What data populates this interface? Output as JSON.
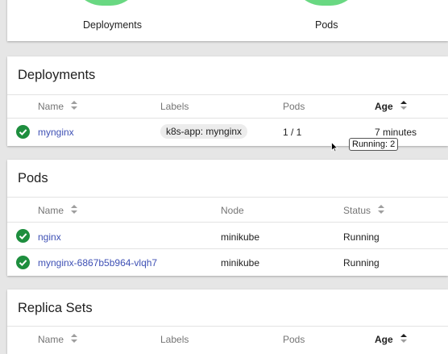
{
  "workloads": {
    "deployments_label": "Deployments",
    "pods_label": "Pods",
    "chart_color": "#69d882"
  },
  "deployments": {
    "title": "Deployments",
    "columns": {
      "name": "Name",
      "labels": "Labels",
      "pods": "Pods",
      "age": "Age"
    },
    "rows": [
      {
        "status": "check-icon",
        "name": "mynginx",
        "label": "k8s-app: mynginx",
        "pods": "1 / 1",
        "age": "7 minutes"
      }
    ],
    "tooltip": "Running: 2"
  },
  "pods": {
    "title": "Pods",
    "columns": {
      "name": "Name",
      "node": "Node",
      "status": "Status"
    },
    "rows": [
      {
        "status_icon": "check-icon",
        "name": "nginx",
        "node": "minikube",
        "status": "Running"
      },
      {
        "status_icon": "check-icon",
        "name": "mynginx-6867b5b964-vlqh7",
        "node": "minikube",
        "status": "Running"
      }
    ]
  },
  "replica_sets": {
    "title": "Replica Sets",
    "columns": {
      "name": "Name",
      "labels": "Labels",
      "pods": "Pods",
      "age": "Age"
    }
  }
}
